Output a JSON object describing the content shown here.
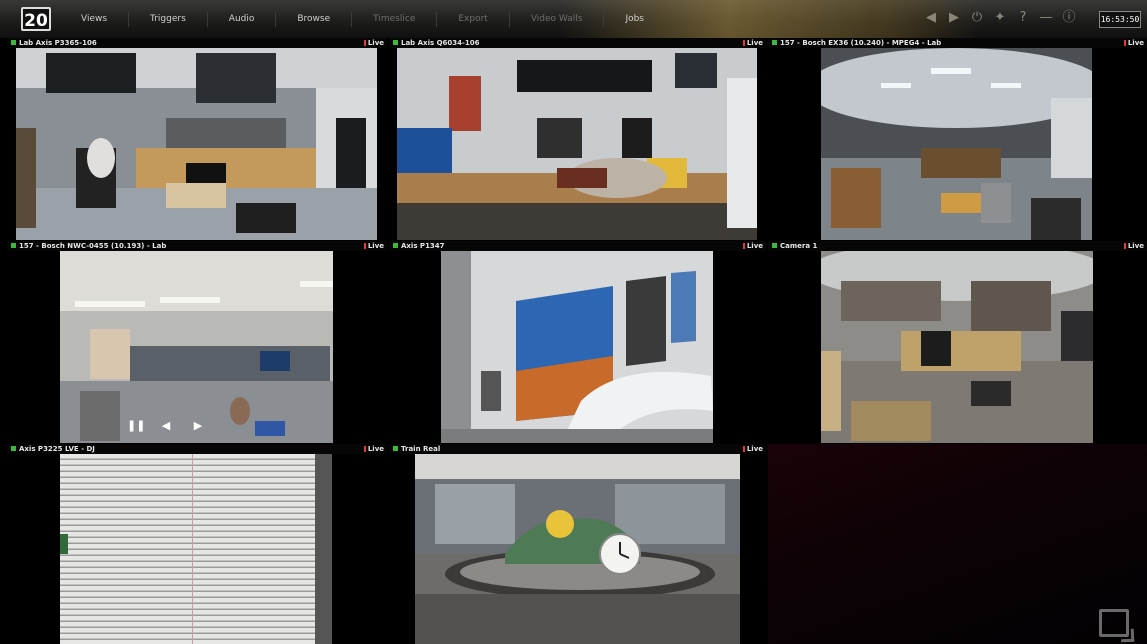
{
  "app": {
    "logo": "20",
    "clock": "16:53:50"
  },
  "nav": [
    {
      "label": "Views",
      "enabled": true
    },
    {
      "label": "Triggers",
      "enabled": true
    },
    {
      "label": "Audio",
      "enabled": true
    },
    {
      "label": "Browse",
      "enabled": true
    },
    {
      "label": "Timeslice",
      "enabled": false
    },
    {
      "label": "Export",
      "enabled": false
    },
    {
      "label": "Video Walls",
      "enabled": false
    },
    {
      "label": "Jobs",
      "enabled": true
    }
  ],
  "toolbar_icons": [
    "back-icon",
    "forward-icon",
    "power-icon",
    "wrench-icon",
    "help-icon",
    "minimize-icon",
    "info-icon"
  ],
  "tiles": [
    {
      "title": "Lab Axis P3365-106",
      "status": "Live"
    },
    {
      "title": "Lab Axis Q6034-106",
      "status": "Live"
    },
    {
      "title": "157 - Bosch EX36 (10.240) - MPEG4 - Lab",
      "status": "Live"
    },
    {
      "title": "157 - Bosch NWC-0455 (10.193) - Lab",
      "status": "Live"
    },
    {
      "title": "Axis P1347",
      "status": "Live"
    },
    {
      "title": "Camera 1",
      "status": "Live"
    },
    {
      "title": "Axis P3225 LVE - DJ",
      "status": "Live"
    },
    {
      "title": "Train Real",
      "status": "Live"
    }
  ],
  "colors": {
    "status_green": "#3cba3c",
    "live_red": "#e23a3a",
    "empty_tile": "#1a0308"
  }
}
